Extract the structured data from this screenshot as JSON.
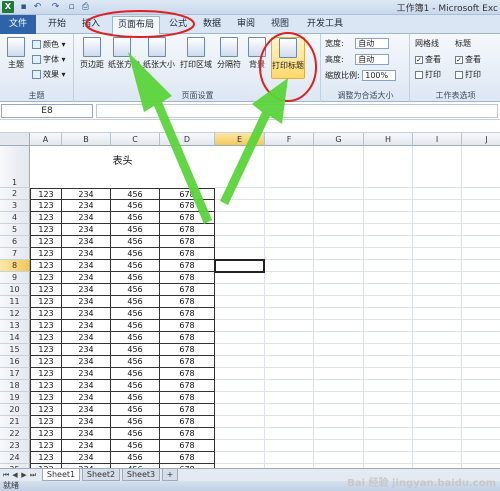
{
  "titlebar": {
    "logo": "X",
    "title": "工作簿1 - Microsoft Exc"
  },
  "tabs": [
    {
      "label": "文件"
    },
    {
      "label": "开始"
    },
    {
      "label": "插入"
    },
    {
      "label": "页面布局"
    },
    {
      "label": "公式"
    },
    {
      "label": "数据"
    },
    {
      "label": "审阅"
    },
    {
      "label": "视图"
    },
    {
      "label": "开发工具"
    }
  ],
  "ribbon": {
    "theme_group": {
      "label": "主题",
      "theme_btn": "主题",
      "colors": "颜色",
      "fonts": "字体",
      "effects": "效果"
    },
    "page_setup_group": {
      "label": "页面设置",
      "margins": "页边距",
      "orientation": "纸张方向",
      "size": "纸张大小",
      "print_area": "打印区域",
      "breaks": "分隔符",
      "background": "背景",
      "print_titles": "打印标题"
    },
    "scale_group": {
      "label": "调整为合适大小",
      "width_label": "宽度:",
      "width_value": "自动",
      "height_label": "高度:",
      "height_value": "自动",
      "scale_label": "缩放比例:",
      "scale_value": "100%"
    },
    "sheet_options_group": {
      "label": "工作表选项",
      "gridlines": "网格线",
      "headings": "标题",
      "view": "查看",
      "print": "打印"
    }
  },
  "formula_bar": {
    "name_box": "E8"
  },
  "grid": {
    "columns": [
      "A",
      "B",
      "C",
      "D",
      "E",
      "F",
      "G",
      "H",
      "I",
      "J"
    ],
    "active_column": "E",
    "active_row": "8",
    "header_title": "表头",
    "rows": [
      "1",
      "2",
      "3",
      "4",
      "5",
      "6",
      "7",
      "8",
      "9",
      "10",
      "11",
      "12",
      "13",
      "14",
      "15",
      "16",
      "17",
      "18",
      "19",
      "20",
      "21",
      "22",
      "23",
      "24",
      "25"
    ],
    "data": [
      [
        "123",
        "234",
        "456",
        "678"
      ],
      [
        "123",
        "234",
        "456",
        "678"
      ],
      [
        "123",
        "234",
        "456",
        "678"
      ],
      [
        "123",
        "234",
        "456",
        "678"
      ],
      [
        "123",
        "234",
        "456",
        "678"
      ],
      [
        "123",
        "234",
        "456",
        "678"
      ],
      [
        "123",
        "234",
        "456",
        "678"
      ],
      [
        "123",
        "234",
        "456",
        "678"
      ],
      [
        "123",
        "234",
        "456",
        "678"
      ],
      [
        "123",
        "234",
        "456",
        "678"
      ],
      [
        "123",
        "234",
        "456",
        "678"
      ],
      [
        "123",
        "234",
        "456",
        "678"
      ],
      [
        "123",
        "234",
        "456",
        "678"
      ],
      [
        "123",
        "234",
        "456",
        "678"
      ],
      [
        "123",
        "234",
        "456",
        "678"
      ],
      [
        "123",
        "234",
        "456",
        "678"
      ],
      [
        "123",
        "234",
        "456",
        "678"
      ],
      [
        "123",
        "234",
        "456",
        "678"
      ],
      [
        "123",
        "234",
        "456",
        "678"
      ],
      [
        "123",
        "234",
        "456",
        "678"
      ],
      [
        "123",
        "234",
        "456",
        "678"
      ],
      [
        "123",
        "234",
        "456",
        "678"
      ],
      [
        "123",
        "234",
        "456",
        "678"
      ],
      [
        "123",
        "234",
        "456",
        "678"
      ]
    ]
  },
  "sheets": [
    {
      "label": "Sheet1"
    },
    {
      "label": "Sheet2"
    },
    {
      "label": "Sheet3"
    }
  ],
  "status": {
    "text": "就绪"
  },
  "watermark": "Bai 经验 jingyan.baidu.com",
  "colors": {
    "annotation_red": "#e02020",
    "annotation_green": "#5ad43a",
    "file_tab": "#2e63a8"
  }
}
